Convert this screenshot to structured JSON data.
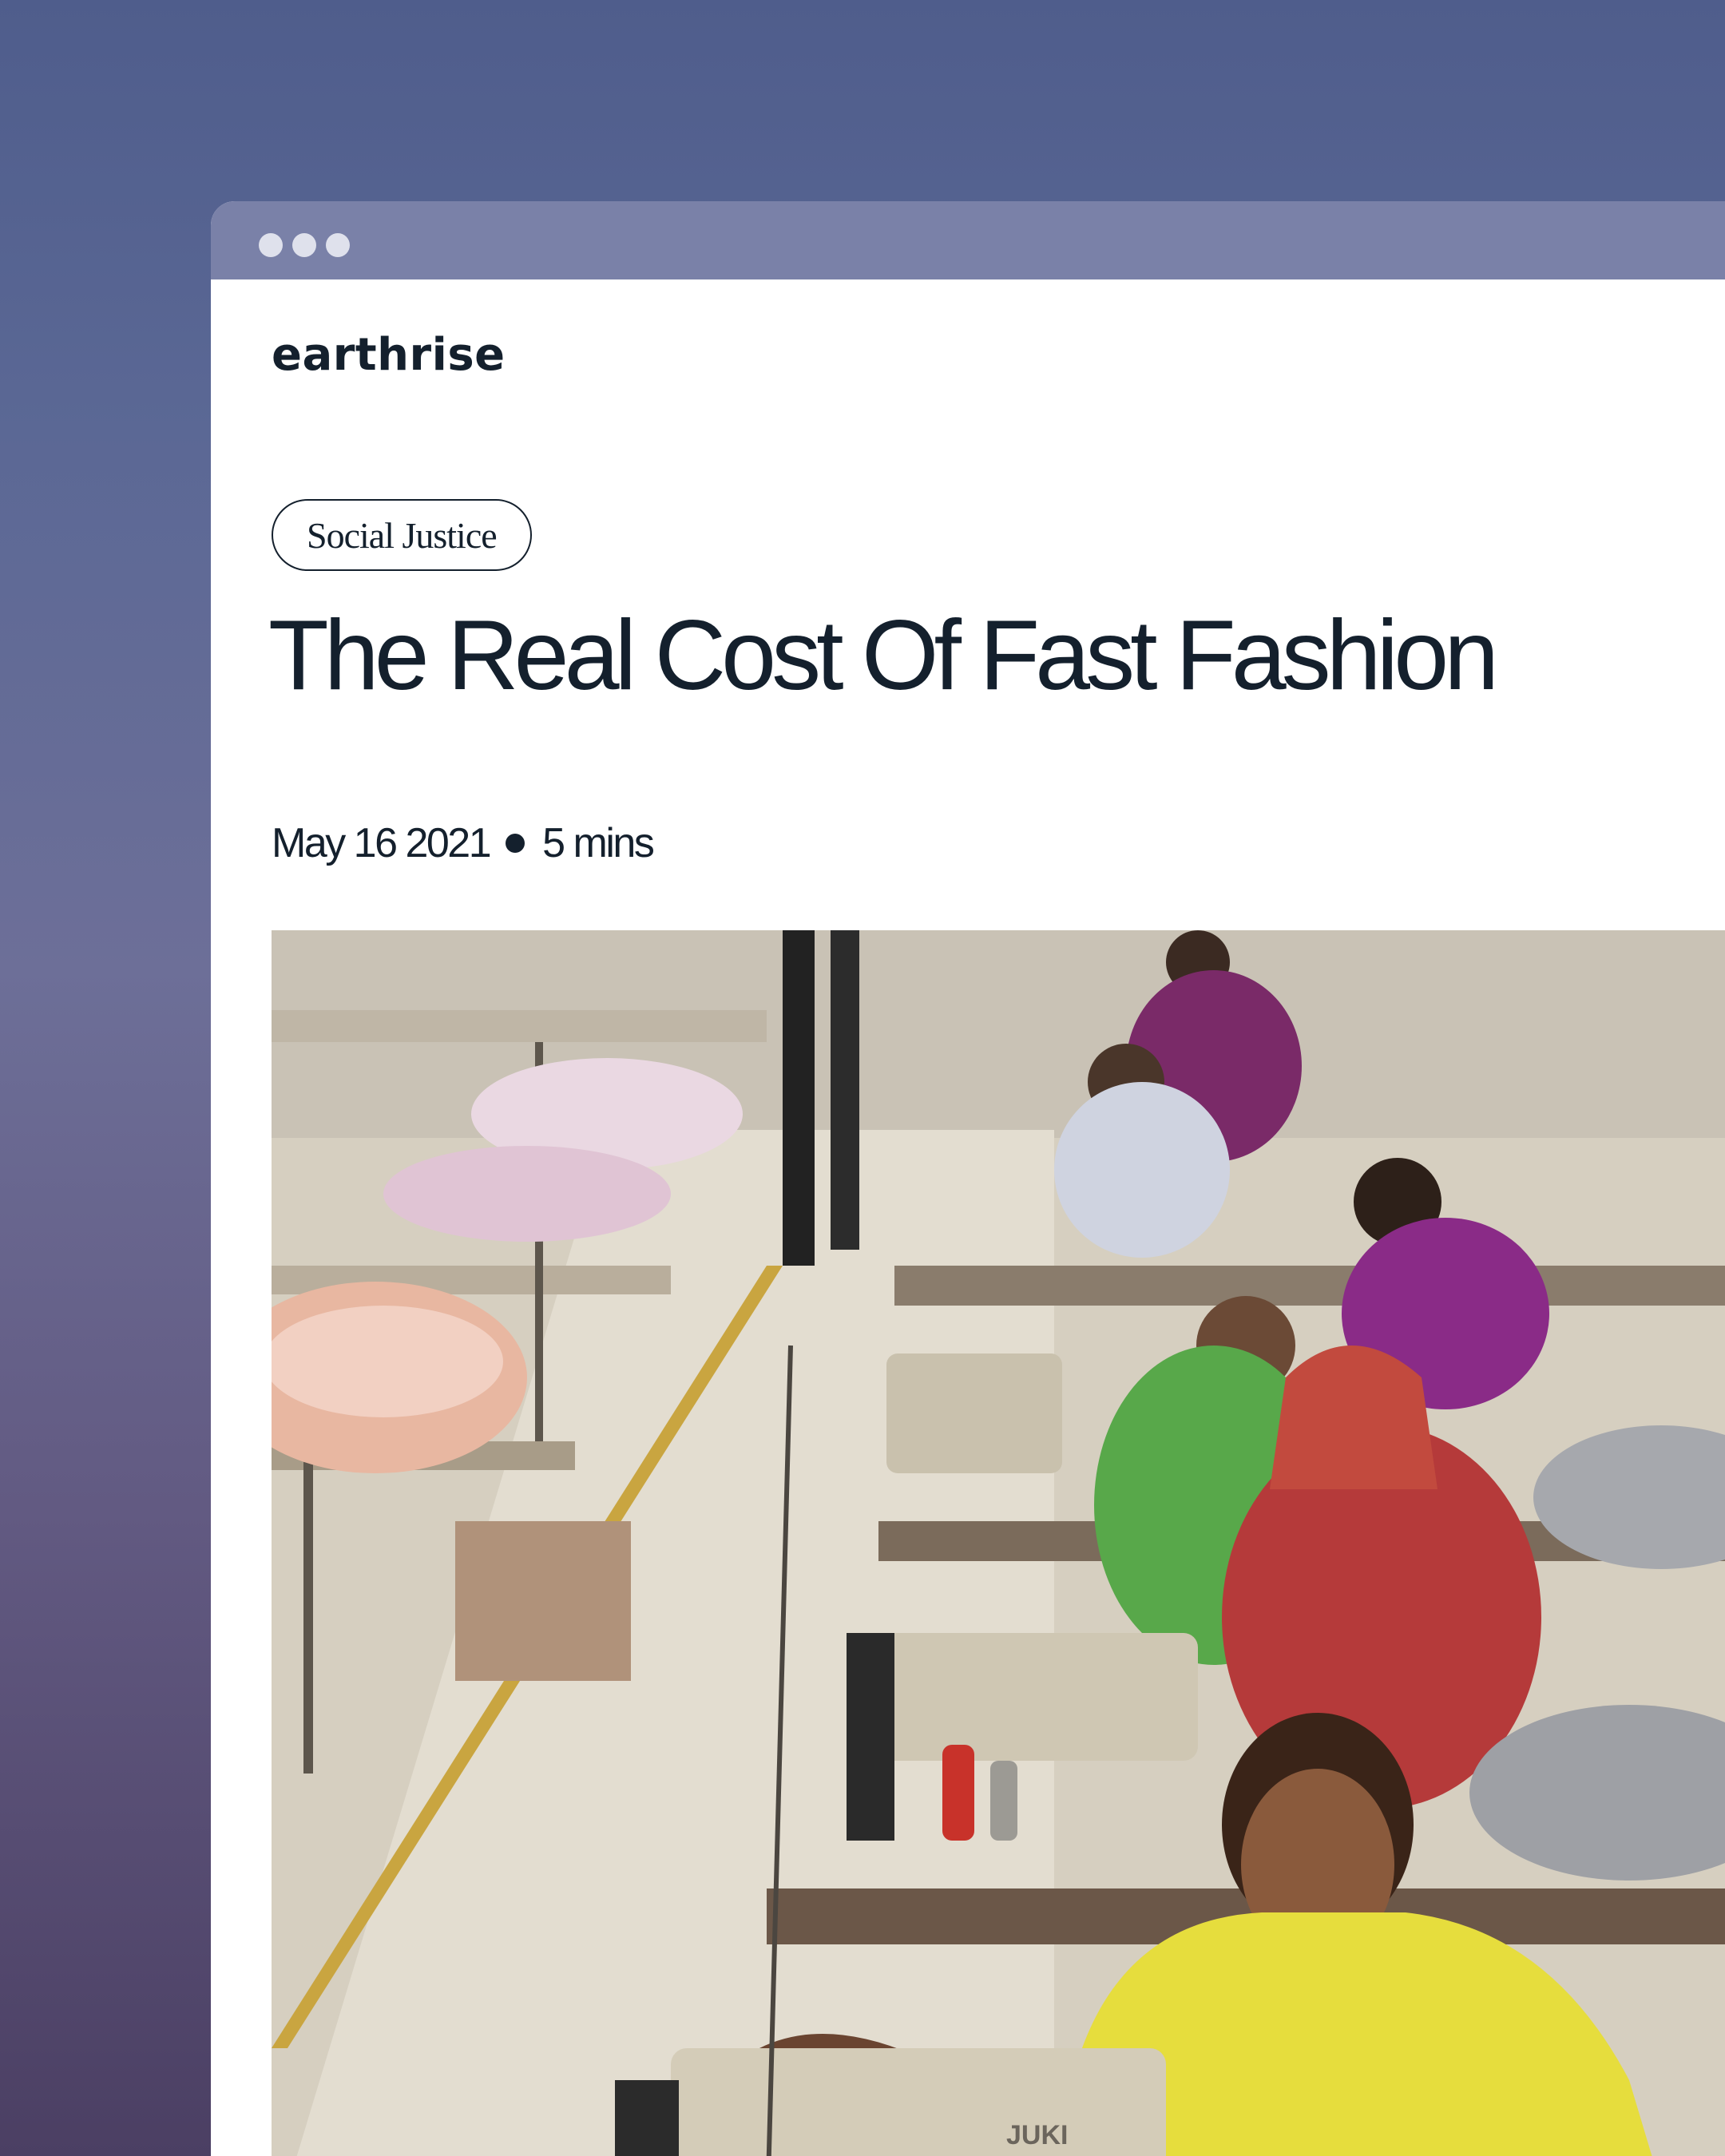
{
  "brand": {
    "name": "earthrise"
  },
  "article": {
    "category": "Social Justice",
    "title": "The Real Cost Of Fast Fashion",
    "date": "May 16 2021",
    "read_time": "5 mins"
  },
  "hero_image": {
    "alt": "Garment workers at sewing machines in a factory",
    "machine_label": "JUKI"
  },
  "colors": {
    "backdrop": "#5b6895",
    "titlebar": "#7a81a8",
    "text": "#14202d"
  }
}
